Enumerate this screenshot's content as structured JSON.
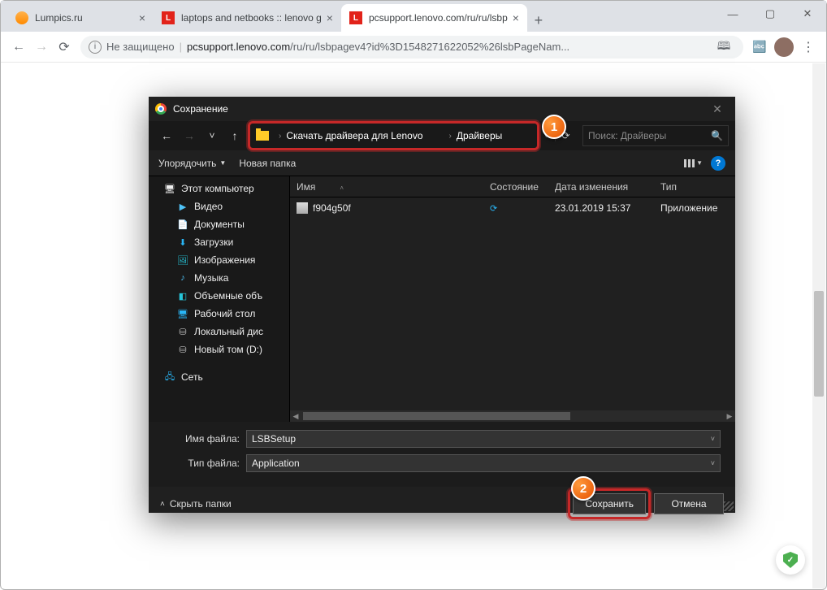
{
  "browser": {
    "tabs": [
      {
        "title": "Lumpics.ru",
        "favicon": "orange"
      },
      {
        "title": "laptops and netbooks :: lenovo g",
        "favicon": "lenovo"
      },
      {
        "title": "pcsupport.lenovo.com/ru/ru/lsbp",
        "favicon": "lenovo",
        "active": true
      }
    ],
    "address": {
      "insecure_label": "Не защищено",
      "url_prefix": "pcsupport.lenovo.com",
      "url_rest": "/ru/ru/lsbpagev4?id%3D1548271622052%26lsbPageNam..."
    }
  },
  "dialog": {
    "title": "Сохранение",
    "breadcrumb": {
      "part1": "Скачать драйвера для Lenovo",
      "part2": "Драйверы"
    },
    "search_placeholder": "Поиск: Драйверы",
    "toolbar": {
      "organize": "Упорядочить",
      "new_folder": "Новая папка"
    },
    "sidebar": {
      "this_pc": "Этот компьютер",
      "videos": "Видео",
      "documents": "Документы",
      "downloads": "Загрузки",
      "pictures": "Изображения",
      "music": "Музыка",
      "objects3d": "Объемные объ",
      "desktop": "Рабочий стол",
      "local_disk": "Локальный дис",
      "new_volume": "Новый том (D:)",
      "network": "Сеть"
    },
    "columns": {
      "name": "Имя",
      "state": "Состояние",
      "date": "Дата изменения",
      "type": "Тип"
    },
    "files": [
      {
        "name": "f904g50f",
        "date": "23.01.2019 15:37",
        "type": "Приложение"
      }
    ],
    "fields": {
      "filename_label": "Имя файла:",
      "filename_value": "LSBSetup",
      "filetype_label": "Тип файла:",
      "filetype_value": "Application"
    },
    "footer": {
      "hide_folders": "Скрыть папки",
      "save": "Сохранить",
      "cancel": "Отмена"
    }
  },
  "callouts": {
    "one": "1",
    "two": "2"
  }
}
